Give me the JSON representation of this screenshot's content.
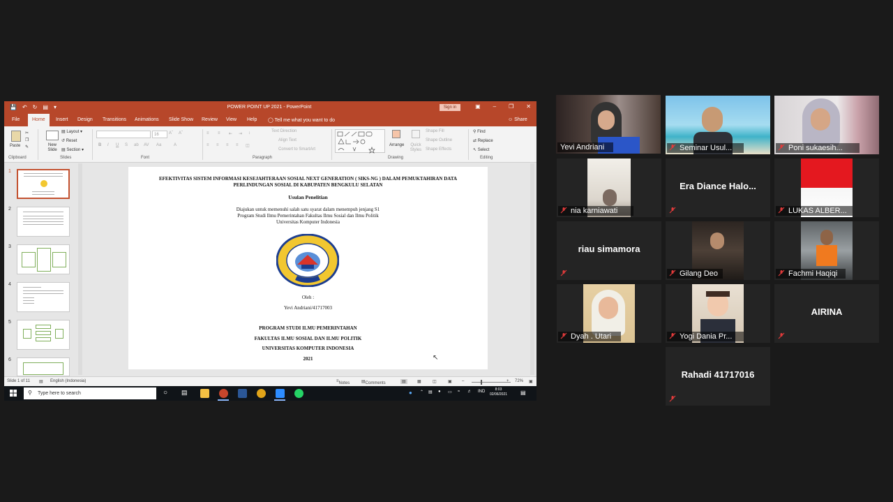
{
  "ppt": {
    "qat_icons": [
      "save-icon",
      "undo-icon",
      "redo-icon",
      "start-presentation-icon"
    ],
    "title": "POWER POINT UP 2021  -  PowerPoint",
    "sign_in": "Sign in",
    "tabs": [
      "File",
      "Home",
      "Insert",
      "Design",
      "Transitions",
      "Animations",
      "Slide Show",
      "Review",
      "View",
      "Help"
    ],
    "tell_me": "Tell me what you want to do",
    "share": "Share",
    "ribbon": {
      "paste": "Paste",
      "clipboard": "Clipboard",
      "new_slide": "New Slide",
      "layout": "Layout",
      "reset": "Reset",
      "section": "Section",
      "slides": "Slides",
      "font": "Font",
      "font_size": "16",
      "paragraph": "Paragraph",
      "text_direction": "Text Direction",
      "align_text": "Align Text",
      "convert_smartart": "Convert to SmartArt",
      "arrange": "Arrange",
      "quick_styles": "Quick Styles",
      "shape_fill": "Shape Fill",
      "shape_outline": "Shape Outline",
      "shape_effects": "Shape Effects",
      "drawing": "Drawing",
      "find": "Find",
      "replace": "Replace",
      "select": "Select",
      "editing": "Editing"
    },
    "thumbnails": [
      "1",
      "2",
      "3",
      "4",
      "5",
      "6"
    ],
    "slide": {
      "title": "EFEKTIVITAS SISTEM INFORMASI KESEJAHTERAAN SOSIAL NEXT GENERATION ( SIKS-NG ) DALAM PEMUKTAHIRAN DATA PERLINDUNGAN SOSIAL DI KABUPATEN BENGKULU SELATAN",
      "subtitle": "Usulan Penelitian",
      "line1": "Diajukan untuk memenuhi salah satu syarat dalam menempuh jenjang S1",
      "line2": "Program Studi Ilmu Pemerintahan Fakultas Ilmu Sosial dan Ilmu Politik",
      "line3": "Universitas  Komputer Indonesia",
      "logo_text_top": "UNIVERSITAS KOMPUTER INDONESIA",
      "logo_text_bottom": "UNIKOM",
      "oleh": "Oleh :",
      "author": "Yevi Andriani/41717003",
      "prodi": "PROGRAM STUDI ILMU PEMERINTAHAN",
      "fakultas": "FAKULTAS ILMU SOSIAL DAN ILMU POLITIK",
      "univ": "UNIVERSITAS KOMPUTER INDONESIA",
      "year": "2021"
    },
    "status": {
      "slide_count": "Slide 1 of 11",
      "language": "English (Indonesia)",
      "notes": "Notes",
      "comments": "Comments",
      "zoom": "72%"
    },
    "taskbar": {
      "search_placeholder": "Type here to search",
      "lang": "IND",
      "time": "8:03",
      "date": "02/06/2021"
    }
  },
  "gallery": {
    "colors": {
      "active_border": "#d6ef5a",
      "tile_bg": "#242424",
      "muted": "#e23b3b"
    },
    "participants": [
      {
        "name": "Yevi Andriani",
        "video": true,
        "muted": false,
        "active": true
      },
      {
        "name": "Seminar Usul...",
        "video": true,
        "muted": true
      },
      {
        "name": "Poni sukaesih...",
        "video": true,
        "muted": true
      },
      {
        "name": "nia karniawati",
        "video": true,
        "muted": true
      },
      {
        "name": "Era  Diance  Halo...",
        "video": false,
        "muted": true
      },
      {
        "name": "LUKAS ALBER...",
        "video": true,
        "muted": true
      },
      {
        "name": "riau simamora",
        "video": false,
        "muted": true
      },
      {
        "name": "Gilang Deo",
        "video": true,
        "muted": true
      },
      {
        "name": "Fachmi Haqiqi",
        "video": true,
        "muted": true
      },
      {
        "name": "Dyah . Utari",
        "video": true,
        "muted": true
      },
      {
        "name": "Yogi Dania Pr...",
        "video": true,
        "muted": true
      },
      {
        "name": "AIRINA",
        "video": false,
        "muted": true
      },
      {
        "name": "Rahadi 41717016",
        "video": false,
        "muted": true
      }
    ]
  }
}
